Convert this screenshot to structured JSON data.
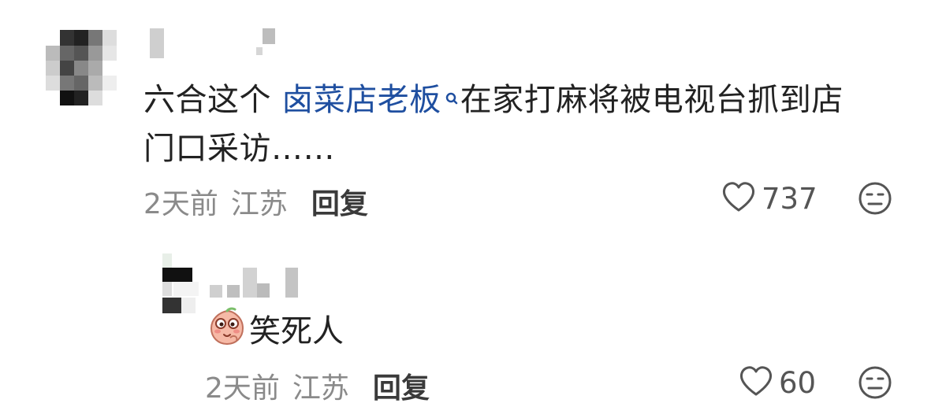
{
  "comment": {
    "text_before_tag": "六合这个 ",
    "tag_text": "卤菜店老板",
    "text_after_tag": "在家打麻将被电视台抓到店",
    "text_line2": "门口采访……",
    "time": "2天前",
    "location": "江苏",
    "reply_label": "回复",
    "like_count": "737",
    "icons": {
      "like": "heart-outline-icon",
      "dislike": "meh-face-icon",
      "tag": "search-icon"
    }
  },
  "reply": {
    "sticker": "peach-laughing-sticker",
    "text": "笑死人",
    "time": "2天前",
    "location": "江苏",
    "reply_label": "回复",
    "like_count": "60"
  },
  "colors": {
    "tag": "#1f4fa0",
    "meta": "#8a8a8a",
    "icon": "#555555"
  }
}
